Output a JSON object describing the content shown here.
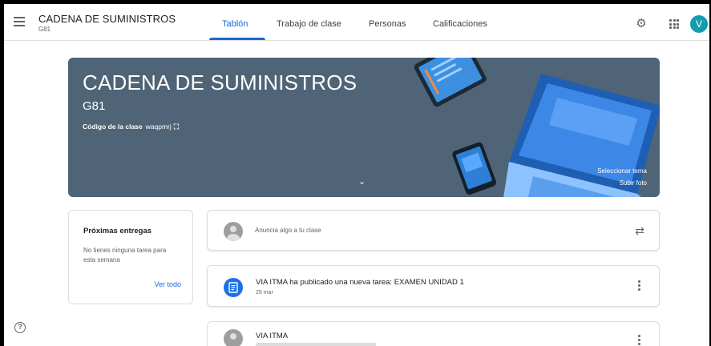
{
  "header": {
    "class_name": "CADENA DE SUMINISTROS",
    "class_section": "G81",
    "tabs": [
      {
        "label": "Tablón",
        "active": true
      },
      {
        "label": "Trabajo de clase",
        "active": false
      },
      {
        "label": "Personas",
        "active": false
      },
      {
        "label": "Calificaciones",
        "active": false
      }
    ],
    "user_initial": "V",
    "icons": [
      "menu-icon",
      "gear-icon",
      "apps-grid-icon"
    ]
  },
  "banner": {
    "title": "CADENA DE SUMINISTROS",
    "section": "G81",
    "code_label": "Código de la clase",
    "code_value": "waqpmrj",
    "select_theme": "Seleccionar tema",
    "upload_photo": "Subir foto",
    "background_color": "#4f6476"
  },
  "upcoming": {
    "title": "Próximas entregas",
    "text": "No tienes ninguna tarea para esta semana",
    "view_all": "Ver todo"
  },
  "announce": {
    "placeholder": "Anuncia algo a tu clase"
  },
  "posts": [
    {
      "title": "VIA ITMA ha publicado una nueva tarea: EXAMEN UNIDAD 1",
      "date": "25 mar",
      "icon": "assignment-icon"
    },
    {
      "title": "VIA ITMA"
    }
  ],
  "colors": {
    "accent": "#1967d2",
    "avatar": "#129eaf"
  }
}
